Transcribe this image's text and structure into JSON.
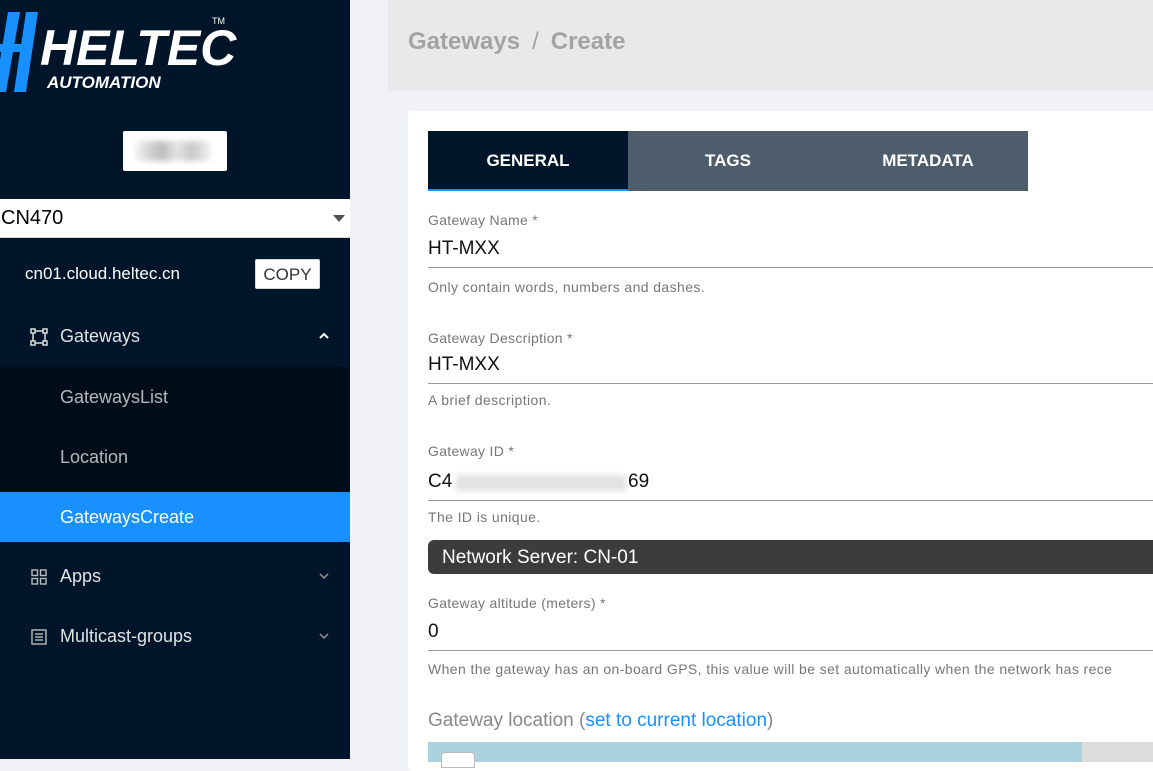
{
  "brand": {
    "name": "HELTEC",
    "sub": "AUTOMATION",
    "tm": "TM",
    "color": "#1890ff"
  },
  "sidebar": {
    "region": "CN470",
    "server_host": "cn01.cloud.heltec.cn",
    "copy_label": "COPY",
    "menu": [
      {
        "label": "Gateways",
        "icon": "gateway-icon",
        "expanded": true
      },
      {
        "label": "Apps",
        "icon": "apps-grid-icon",
        "expanded": false
      },
      {
        "label": "Multicast-groups",
        "icon": "multicast-icon",
        "expanded": false
      }
    ],
    "submenu": [
      "GatewaysList",
      "Location",
      "GatewaysCreate"
    ],
    "active_sub": "GatewaysCreate"
  },
  "header": {
    "crumb1": "Gateways",
    "sep": "/",
    "crumb2": "Create"
  },
  "tabs": [
    "GENERAL",
    "TAGS",
    "METADATA"
  ],
  "form": {
    "name": {
      "label": "Gateway Name *",
      "value": "HT-MXX",
      "help": "Only contain words, numbers and dashes."
    },
    "description": {
      "label": "Gateway Description *",
      "value": "HT-MXX",
      "help": "A brief description."
    },
    "id": {
      "label": "Gateway ID *",
      "value_start": "C4",
      "value_end": "69",
      "help": "The ID is unique."
    },
    "network_server": "Network Server: CN-01",
    "altitude": {
      "label": "Gateway altitude (meters) *",
      "value": "0",
      "help": "When the gateway has an on-board GPS, this value will be set automatically when the network has rece"
    },
    "location": {
      "title": "Gateway location (",
      "link": "set to current location",
      "close": ")"
    }
  }
}
